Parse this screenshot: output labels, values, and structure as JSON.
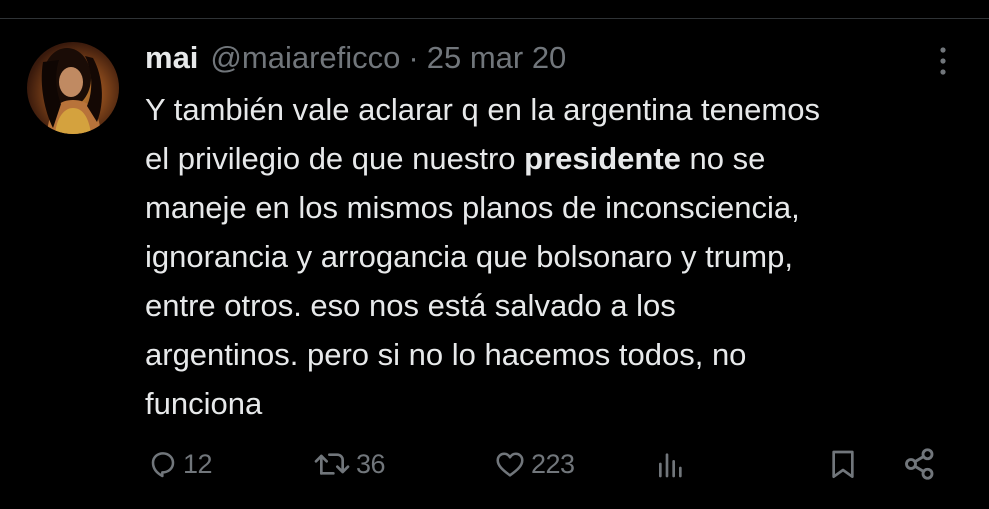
{
  "tweet": {
    "display_name": "mai",
    "handle": "@maiareficco",
    "separator": "·",
    "timestamp": "25 mar 20",
    "text_lines": [
      {
        "pre": "Y también vale aclarar q en la argentina tenemos",
        "bold": "",
        "post": ""
      },
      {
        "pre": "el privilegio de que nuestro ",
        "bold": "presidente",
        "post": " no se"
      },
      {
        "pre": "maneje en los mismos planos de inconsciencia,",
        "bold": "",
        "post": ""
      },
      {
        "pre": "ignorancia y arrogancia que bolsonaro y trump,",
        "bold": "",
        "post": ""
      },
      {
        "pre": "entre otros. eso nos está salvado a los",
        "bold": "",
        "post": ""
      },
      {
        "pre": "argentinos. pero si no lo hacemos todos, no",
        "bold": "",
        "post": ""
      },
      {
        "pre": "funciona",
        "bold": "",
        "post": ""
      }
    ]
  },
  "actions": {
    "reply_count": "12",
    "retweet_count": "36",
    "like_count": "223"
  },
  "icons": {
    "more": "more-vertical-icon",
    "reply": "reply-icon",
    "retweet": "retweet-icon",
    "like": "heart-icon",
    "views": "bar-chart-icon",
    "bookmark": "bookmark-icon",
    "share": "share-icon"
  },
  "colors": {
    "background": "#000000",
    "text_primary": "#e7e9ea",
    "text_secondary": "#71767b",
    "divider": "#2f3336"
  }
}
